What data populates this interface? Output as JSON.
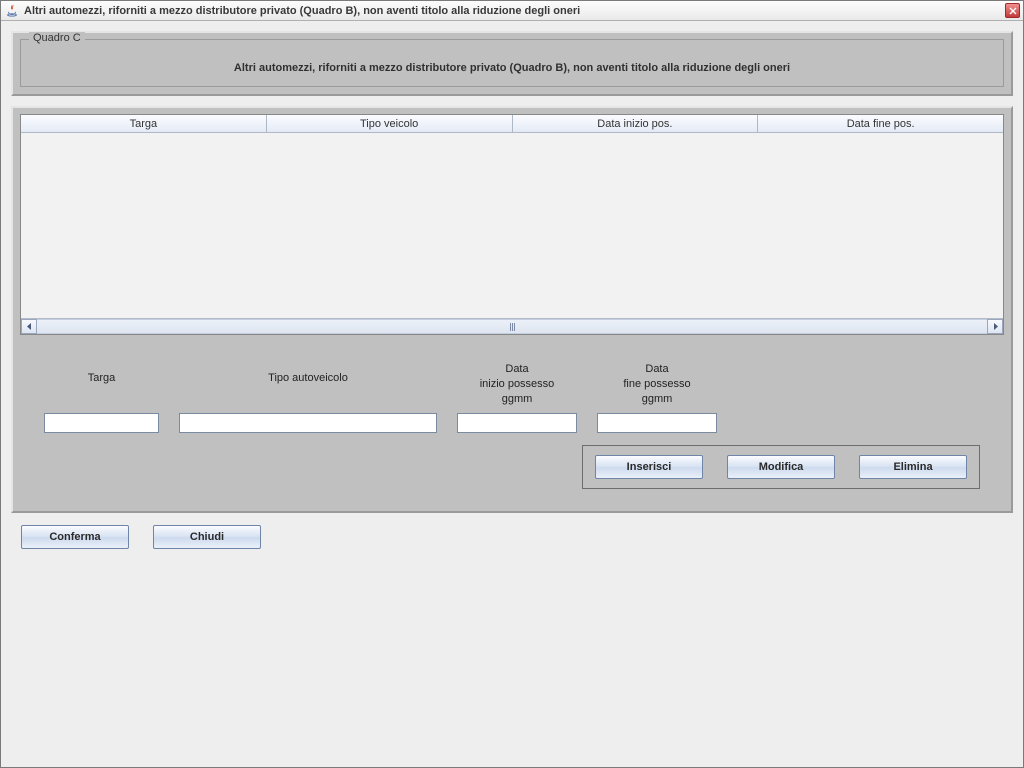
{
  "window": {
    "title": "Altri automezzi, riforniti a mezzo distributore privato (Quadro B), non aventi titolo alla riduzione degli oneri"
  },
  "panel": {
    "legend": "Quadro C",
    "title": "Altri automezzi, riforniti a mezzo distributore privato (Quadro B), non aventi titolo alla riduzione degli oneri"
  },
  "table": {
    "columns": [
      "Targa",
      "Tipo veicolo",
      "Data inizio pos.",
      "Data fine pos."
    ],
    "rows": []
  },
  "form": {
    "labels": {
      "targa": "Targa",
      "tipo": "Tipo autoveicolo",
      "dataInizioL1": "Data",
      "dataInizioL2": "inizio possesso",
      "dataInizioL3": "ggmm",
      "dataFineL1": "Data",
      "dataFineL2": "fine possesso",
      "dataFineL3": "ggmm"
    },
    "values": {
      "targa": "",
      "tipo": "",
      "dataInizio": "",
      "dataFine": ""
    }
  },
  "buttons": {
    "inserisci": "Inserisci",
    "modifica": "Modifica",
    "elimina": "Elimina",
    "conferma": "Conferma",
    "chiudi": "Chiudi"
  }
}
